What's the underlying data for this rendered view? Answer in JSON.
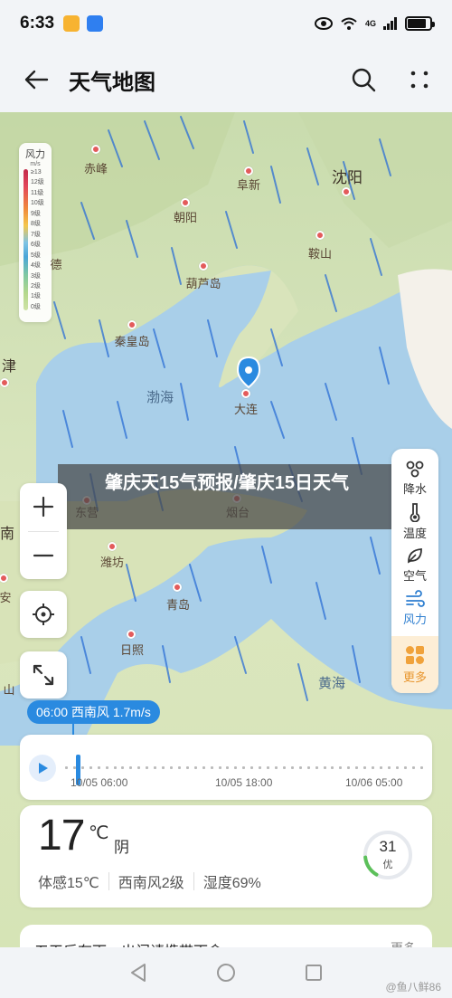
{
  "status_bar": {
    "time": "6:33",
    "signal": "4G",
    "battery_level": 0.85
  },
  "app_bar": {
    "title": "天气地图"
  },
  "map": {
    "legend": {
      "title": "风力",
      "unit": "m/s",
      "ticks": [
        "≥13",
        "12级",
        "11级",
        "10级",
        "9级",
        "8级",
        "7级",
        "6级",
        "5级",
        "4级",
        "3级",
        "2级",
        "1级",
        "0级"
      ]
    },
    "cities": [
      "赤峰",
      "阜新",
      "沈阳",
      "朝阳",
      "鞍山",
      "德",
      "葫芦岛",
      "秦皇岛",
      "津",
      "大连",
      "东营",
      "烟台",
      "南",
      "潍坊",
      "安",
      "青岛",
      "日照",
      "山"
    ],
    "seas": [
      "渤海",
      "黄海"
    ],
    "headline": "肇庆天15气预报/肇庆15日天气"
  },
  "layers": [
    {
      "label": "降水",
      "icon": "rain-icon",
      "active": false
    },
    {
      "label": "温度",
      "icon": "thermometer-icon",
      "active": false
    },
    {
      "label": "空气",
      "icon": "leaf-icon",
      "active": false
    },
    {
      "label": "风力",
      "icon": "wind-icon",
      "active": true
    },
    {
      "label": "更多",
      "icon": "grid-icon",
      "active": false
    }
  ],
  "wind_tooltip": "06:00 西南风 1.7m/s",
  "timeline": {
    "labels": [
      "10/05 06:00",
      "10/05 18:00",
      "10/06 05:00"
    ],
    "progress": 0.02
  },
  "weather": {
    "temperature": "17",
    "unit": "℃",
    "condition": "阴",
    "feels_like": "体感15℃",
    "wind": "西南风2级",
    "humidity": "湿度69%",
    "aqi_value": "31",
    "aqi_label": "优",
    "aqi_fraction": 0.18
  },
  "notice": {
    "text": "五天后有雨，出门请携带雨伞",
    "more": "更多"
  },
  "watermark": "@鱼八鲜86",
  "colors": {
    "accent": "#2a8ae0",
    "aqi_good": "#5cc05a",
    "more_bg": "#fdeed6"
  }
}
